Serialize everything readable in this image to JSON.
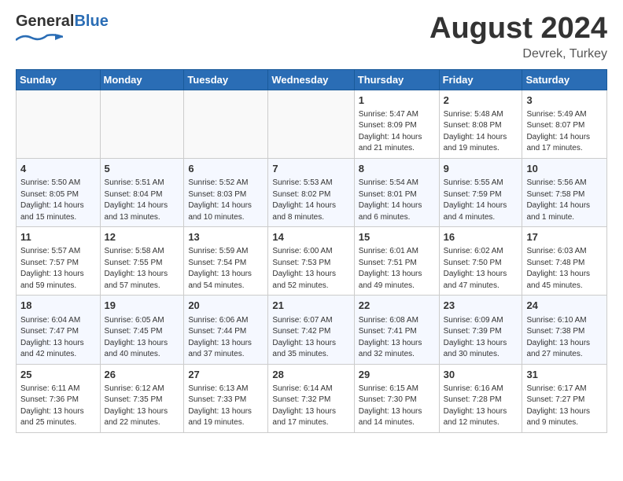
{
  "logo": {
    "general": "General",
    "blue": "Blue"
  },
  "title": "August 2024",
  "subtitle": "Devrek, Turkey",
  "days_of_week": [
    "Sunday",
    "Monday",
    "Tuesday",
    "Wednesday",
    "Thursday",
    "Friday",
    "Saturday"
  ],
  "weeks": [
    [
      {
        "day": "",
        "info": ""
      },
      {
        "day": "",
        "info": ""
      },
      {
        "day": "",
        "info": ""
      },
      {
        "day": "",
        "info": ""
      },
      {
        "day": "1",
        "info": "Sunrise: 5:47 AM\nSunset: 8:09 PM\nDaylight: 14 hours\nand 21 minutes."
      },
      {
        "day": "2",
        "info": "Sunrise: 5:48 AM\nSunset: 8:08 PM\nDaylight: 14 hours\nand 19 minutes."
      },
      {
        "day": "3",
        "info": "Sunrise: 5:49 AM\nSunset: 8:07 PM\nDaylight: 14 hours\nand 17 minutes."
      }
    ],
    [
      {
        "day": "4",
        "info": "Sunrise: 5:50 AM\nSunset: 8:05 PM\nDaylight: 14 hours\nand 15 minutes."
      },
      {
        "day": "5",
        "info": "Sunrise: 5:51 AM\nSunset: 8:04 PM\nDaylight: 14 hours\nand 13 minutes."
      },
      {
        "day": "6",
        "info": "Sunrise: 5:52 AM\nSunset: 8:03 PM\nDaylight: 14 hours\nand 10 minutes."
      },
      {
        "day": "7",
        "info": "Sunrise: 5:53 AM\nSunset: 8:02 PM\nDaylight: 14 hours\nand 8 minutes."
      },
      {
        "day": "8",
        "info": "Sunrise: 5:54 AM\nSunset: 8:01 PM\nDaylight: 14 hours\nand 6 minutes."
      },
      {
        "day": "9",
        "info": "Sunrise: 5:55 AM\nSunset: 7:59 PM\nDaylight: 14 hours\nand 4 minutes."
      },
      {
        "day": "10",
        "info": "Sunrise: 5:56 AM\nSunset: 7:58 PM\nDaylight: 14 hours\nand 1 minute."
      }
    ],
    [
      {
        "day": "11",
        "info": "Sunrise: 5:57 AM\nSunset: 7:57 PM\nDaylight: 13 hours\nand 59 minutes."
      },
      {
        "day": "12",
        "info": "Sunrise: 5:58 AM\nSunset: 7:55 PM\nDaylight: 13 hours\nand 57 minutes."
      },
      {
        "day": "13",
        "info": "Sunrise: 5:59 AM\nSunset: 7:54 PM\nDaylight: 13 hours\nand 54 minutes."
      },
      {
        "day": "14",
        "info": "Sunrise: 6:00 AM\nSunset: 7:53 PM\nDaylight: 13 hours\nand 52 minutes."
      },
      {
        "day": "15",
        "info": "Sunrise: 6:01 AM\nSunset: 7:51 PM\nDaylight: 13 hours\nand 49 minutes."
      },
      {
        "day": "16",
        "info": "Sunrise: 6:02 AM\nSunset: 7:50 PM\nDaylight: 13 hours\nand 47 minutes."
      },
      {
        "day": "17",
        "info": "Sunrise: 6:03 AM\nSunset: 7:48 PM\nDaylight: 13 hours\nand 45 minutes."
      }
    ],
    [
      {
        "day": "18",
        "info": "Sunrise: 6:04 AM\nSunset: 7:47 PM\nDaylight: 13 hours\nand 42 minutes."
      },
      {
        "day": "19",
        "info": "Sunrise: 6:05 AM\nSunset: 7:45 PM\nDaylight: 13 hours\nand 40 minutes."
      },
      {
        "day": "20",
        "info": "Sunrise: 6:06 AM\nSunset: 7:44 PM\nDaylight: 13 hours\nand 37 minutes."
      },
      {
        "day": "21",
        "info": "Sunrise: 6:07 AM\nSunset: 7:42 PM\nDaylight: 13 hours\nand 35 minutes."
      },
      {
        "day": "22",
        "info": "Sunrise: 6:08 AM\nSunset: 7:41 PM\nDaylight: 13 hours\nand 32 minutes."
      },
      {
        "day": "23",
        "info": "Sunrise: 6:09 AM\nSunset: 7:39 PM\nDaylight: 13 hours\nand 30 minutes."
      },
      {
        "day": "24",
        "info": "Sunrise: 6:10 AM\nSunset: 7:38 PM\nDaylight: 13 hours\nand 27 minutes."
      }
    ],
    [
      {
        "day": "25",
        "info": "Sunrise: 6:11 AM\nSunset: 7:36 PM\nDaylight: 13 hours\nand 25 minutes."
      },
      {
        "day": "26",
        "info": "Sunrise: 6:12 AM\nSunset: 7:35 PM\nDaylight: 13 hours\nand 22 minutes."
      },
      {
        "day": "27",
        "info": "Sunrise: 6:13 AM\nSunset: 7:33 PM\nDaylight: 13 hours\nand 19 minutes."
      },
      {
        "day": "28",
        "info": "Sunrise: 6:14 AM\nSunset: 7:32 PM\nDaylight: 13 hours\nand 17 minutes."
      },
      {
        "day": "29",
        "info": "Sunrise: 6:15 AM\nSunset: 7:30 PM\nDaylight: 13 hours\nand 14 minutes."
      },
      {
        "day": "30",
        "info": "Sunrise: 6:16 AM\nSunset: 7:28 PM\nDaylight: 13 hours\nand 12 minutes."
      },
      {
        "day": "31",
        "info": "Sunrise: 6:17 AM\nSunset: 7:27 PM\nDaylight: 13 hours\nand 9 minutes."
      }
    ]
  ]
}
